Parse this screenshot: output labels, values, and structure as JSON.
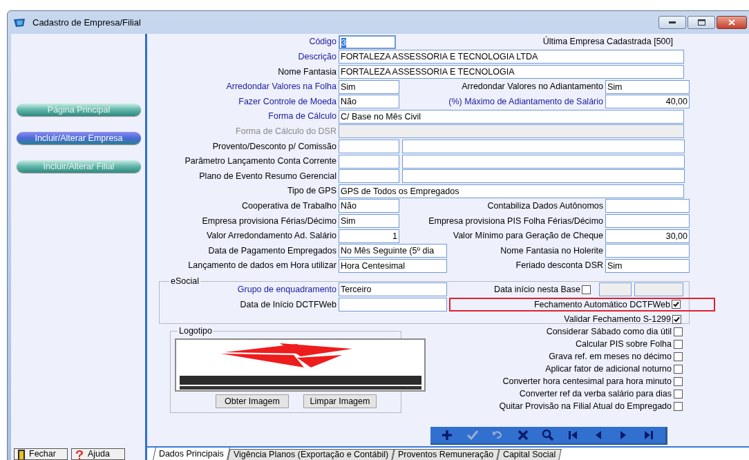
{
  "window": {
    "title": "Cadastro de Empresa/Filial"
  },
  "sidebar": {
    "buttons": [
      {
        "label": "Página Principal",
        "selected": false
      },
      {
        "label": "Incluir/Alterar Empresa",
        "selected": true
      },
      {
        "label": "Incluir/Alterar Filial",
        "selected": false
      }
    ]
  },
  "form": {
    "rows": [
      {
        "kind": "code",
        "label": "Código",
        "required": true,
        "value": "3",
        "focused": true,
        "note": "Última Empresa Cadastrada [500]"
      },
      {
        "kind": "full",
        "label": "Descrição",
        "required": true,
        "value": "FORTALEZA ASSESSORIA E TECNOLOGIA LTDA"
      },
      {
        "kind": "full",
        "label": "Nome Fantasia",
        "required": false,
        "value": "FORTALEZA ASSESSORIA E TECNOLOGIA"
      },
      {
        "kind": "pair",
        "label": "Arredondar Valores na Folha",
        "required": true,
        "value": "Sim",
        "right": {
          "label": "Arredondar Valores no Adiantamento",
          "required": false,
          "value": "Sim"
        }
      },
      {
        "kind": "pair",
        "label": "Fazer Controle de Moeda",
        "required": true,
        "value": "Não",
        "right": {
          "label": "(%) Máximo de Adiantamento de Salário",
          "required": true,
          "value": "40,00",
          "numeric": true
        }
      },
      {
        "kind": "full",
        "label": "Forma de Cálculo",
        "required": true,
        "value": "C/ Base no Mês Civil"
      },
      {
        "kind": "full",
        "label": "Forma de Cálculo do DSR",
        "required": false,
        "disabled": true
      },
      {
        "kind": "split",
        "label": "Provento/Desconto p/ Comissão",
        "required": false
      },
      {
        "kind": "split",
        "label": "Parâmetro Lançamento Conta Corrente",
        "required": false
      },
      {
        "kind": "split",
        "label": "Plano de Evento Resumo Gerencial",
        "required": false
      },
      {
        "kind": "full",
        "label": "Tipo de GPS",
        "required": false,
        "value": "GPS de Todos os Empregados"
      },
      {
        "kind": "pair",
        "label": "Cooperativa de Trabalho",
        "required": false,
        "value": "Não",
        "right": {
          "label": "Contabiliza Dados Autônomos",
          "required": false
        }
      },
      {
        "kind": "pair",
        "label": "Empresa provisiona Férias/Décimo",
        "required": false,
        "value": "Sim",
        "right": {
          "label": "Empresa provisiona PIS Folha Férias/Décimo",
          "required": false
        }
      },
      {
        "kind": "pair",
        "label": "Valor Arredondamento Ad. Salário",
        "required": false,
        "value": "1",
        "numeric": true,
        "right": {
          "label": "Valor Mínimo para Geração de Cheque",
          "required": false,
          "value": "30,00",
          "numeric": true
        }
      },
      {
        "kind": "pair_wide",
        "label": "Data de Pagamento Empregados",
        "required": false,
        "value": "No Mês Seguinte (5º dia",
        "right": {
          "label": "Nome Fantasia no Holerite",
          "required": false
        }
      },
      {
        "kind": "pair_wide",
        "label": "Lançamento de dados em Hora utilizar",
        "required": false,
        "value": "Hora Centesimal",
        "right": {
          "label": "Feriado desconta DSR",
          "required": false,
          "value": "Sim"
        }
      }
    ]
  },
  "esocial": {
    "title": "eSocial",
    "rows": [
      {
        "label": "Grupo de enquadramento",
        "required": true,
        "value": "Terceiro",
        "check": {
          "label": "Data início nesta Base",
          "checked": false,
          "highlighted": false,
          "kind": "dates"
        }
      },
      {
        "label": "Data de Início DCTFWeb",
        "required": false,
        "check": {
          "label": "Fechamento Automático DCTFWeb",
          "checked": true,
          "highlighted": true
        }
      },
      {
        "check": {
          "label": "Validar Fechamento S-1299",
          "checked": true,
          "highlighted": false
        }
      }
    ]
  },
  "logo": {
    "title": "Logotipo",
    "buttons": [
      "Obter Imagem",
      "Limpar Imagem"
    ]
  },
  "options": [
    {
      "label": "Considerar Sábado como dia útil",
      "checked": false
    },
    {
      "label": "Calcular PIS sobre Folha",
      "checked": false
    },
    {
      "label": "Grava ref. em meses no décimo",
      "checked": false
    },
    {
      "label": "Aplicar fator de adicional noturno",
      "checked": false
    },
    {
      "label": "Converter hora centesimal para hora minuto",
      "checked": false
    },
    {
      "label": "Converter ref da verba salário para dias",
      "checked": false
    },
    {
      "label": "Quitar Provisão na Filial Atual do Empregado",
      "checked": false
    }
  ],
  "toolbar": [
    {
      "kind": "add",
      "disabled": false
    },
    {
      "kind": "confirm",
      "disabled": true
    },
    {
      "kind": "undo",
      "disabled": true
    },
    {
      "kind": "delete",
      "disabled": false
    },
    {
      "kind": "search",
      "disabled": false
    },
    {
      "kind": "first",
      "disabled": false
    },
    {
      "kind": "previous",
      "disabled": false
    },
    {
      "kind": "next",
      "disabled": false
    },
    {
      "kind": "last",
      "disabled": false
    }
  ],
  "footer_buttons": [
    {
      "kind": "close",
      "label": "Fechar"
    },
    {
      "kind": "help",
      "label": "Ajuda"
    }
  ],
  "tabs": [
    {
      "label": "Dados Principais",
      "selected": true
    },
    {
      "label": "Vigência Planos (Exportação e Contábil)",
      "selected": false
    },
    {
      "label": "Proventos Remuneração",
      "selected": false
    },
    {
      "label": "Capital Social",
      "selected": false
    }
  ]
}
